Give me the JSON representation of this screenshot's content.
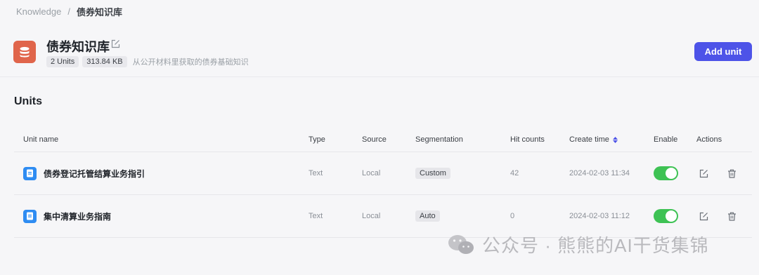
{
  "breadcrumb": {
    "root": "Knowledge",
    "separator": "/",
    "current": "债券知识库"
  },
  "knowledge_base": {
    "title": "债券知识库",
    "unit_count": "2 Units",
    "size": "313.84 KB",
    "description": "从公开材料里获取的债券基础知识",
    "icon": "database-icon",
    "icon_color": "#e0654b"
  },
  "actions": {
    "add_unit_label": "Add unit",
    "accent": "#4d53e8"
  },
  "section": {
    "title": "Units"
  },
  "table": {
    "columns": {
      "name": "Unit name",
      "type": "Type",
      "source": "Source",
      "segmentation": "Segmentation",
      "hits": "Hit counts",
      "created": "Create time",
      "enable": "Enable",
      "actions": "Actions"
    },
    "rows": [
      {
        "name": "债券登记托管结算业务指引",
        "type": "Text",
        "source": "Local",
        "segmentation": "Custom",
        "hits": "42",
        "created": "2024-02-03 11:34",
        "enabled": true
      },
      {
        "name": "集中清算业务指南",
        "type": "Text",
        "source": "Local",
        "segmentation": "Auto",
        "hits": "0",
        "created": "2024-02-03 11:12",
        "enabled": true
      }
    ]
  },
  "watermark": {
    "text": "公众号 · 熊熊的AI干货集锦"
  },
  "colors": {
    "toggle_on": "#3ec254",
    "doc_icon": "#2e8cf2"
  }
}
